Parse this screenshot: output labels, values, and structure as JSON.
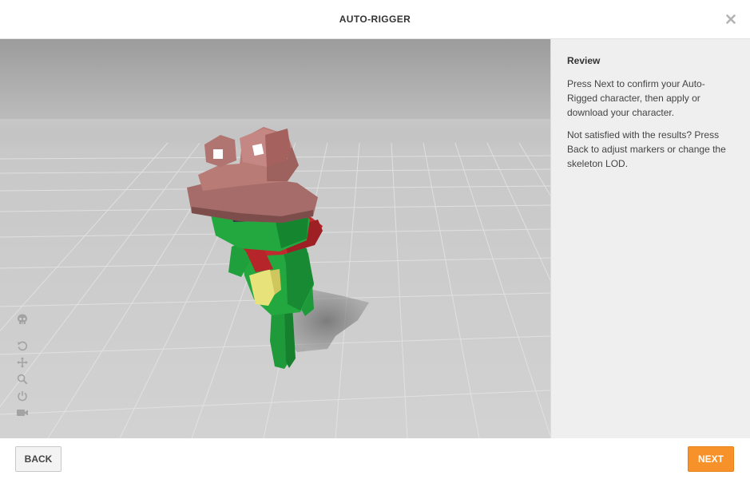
{
  "header": {
    "title": "AUTO-RIGGER",
    "close_icon": "close-icon"
  },
  "panel": {
    "title": "Review",
    "paragraphs": [
      "Press Next to confirm your Auto-Rigged character, then apply or download your character.",
      "Not satisfied with the results? Press Back to adjust markers or change the skeleton LOD."
    ]
  },
  "toolbar": {
    "tools": [
      "skull-icon",
      "rotate-icon",
      "move-icon",
      "zoom-icon",
      "power-icon",
      "camera-icon"
    ]
  },
  "footer": {
    "back_label": "BACK",
    "next_label": "NEXT"
  },
  "colors": {
    "accent": "#f7922b",
    "panel_bg": "#efefef"
  }
}
